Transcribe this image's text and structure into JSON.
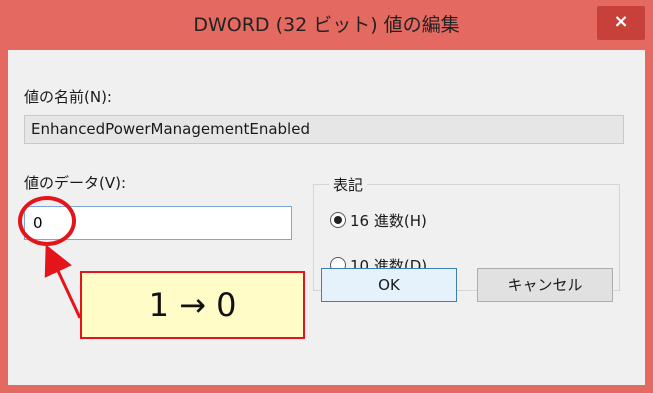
{
  "window": {
    "title": "DWORD (32 ビット) 値の編集",
    "close_glyph": "×",
    "accent_color": "#e46a61",
    "close_color": "#c7403a"
  },
  "value_name": {
    "label": "値の名前(N):",
    "value": "EnhancedPowerManagementEnabled"
  },
  "value_data": {
    "label": "値のデータ(V):",
    "value": "0"
  },
  "base_group": {
    "legend": "表記",
    "options": [
      {
        "label": "16 進数(H)",
        "selected": true
      },
      {
        "label": "10 進数(D)",
        "selected": false
      }
    ]
  },
  "buttons": {
    "ok": "OK",
    "cancel": "キャンセル"
  },
  "annotation": {
    "text": "1 → 0",
    "color": "#e4141b",
    "box_fill": "#fffcc8"
  }
}
